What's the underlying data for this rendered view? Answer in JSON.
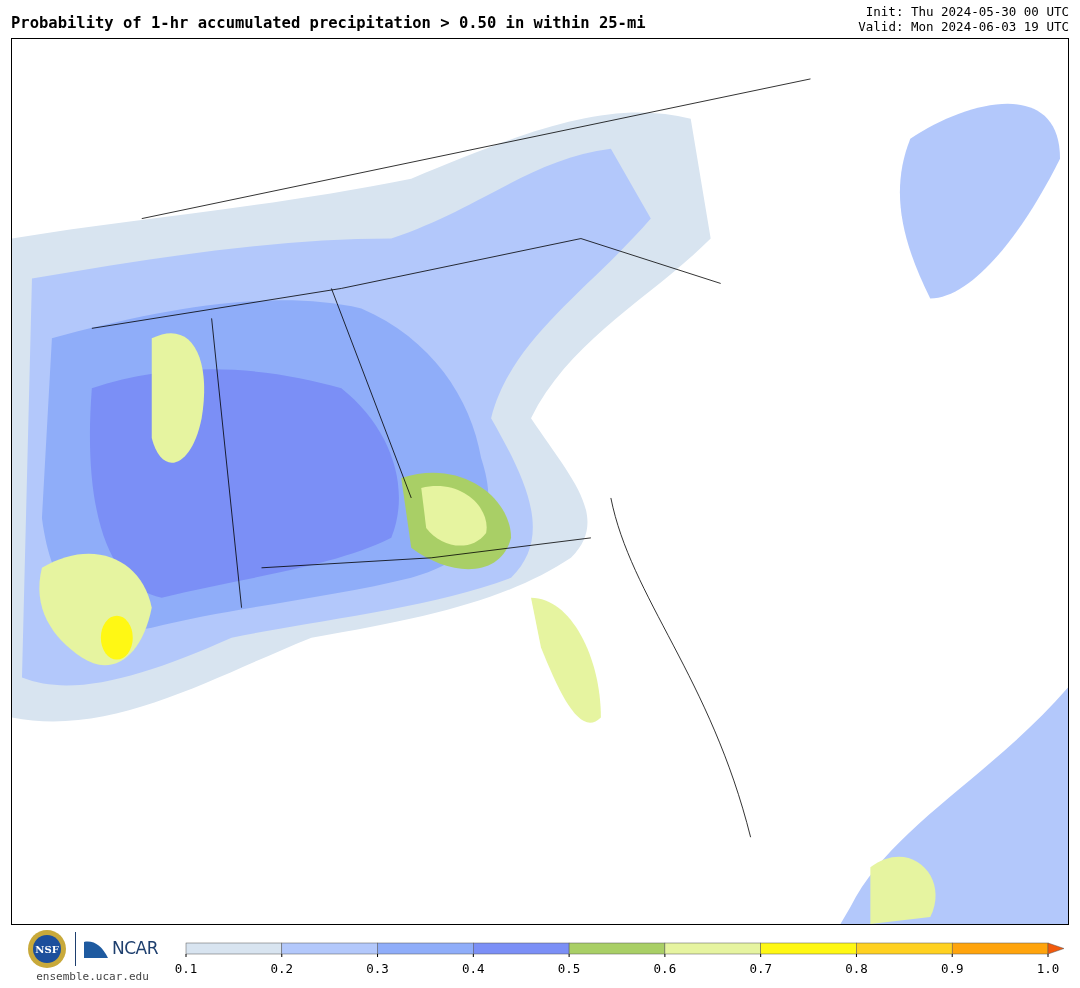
{
  "title": "Probability of 1-hr accumulated precipitation > 0.50 in within 25-mi",
  "init": "Init: Thu 2024-05-30 00 UTC",
  "valid": "Valid: Mon 2024-06-03 19 UTC",
  "logos": {
    "nsf": "NSF",
    "ncar": "NCAR",
    "site": "ensemble.ucar.edu"
  },
  "colorbar": {
    "bins": [
      {
        "color": "#d8e4f0"
      },
      {
        "color": "#b3c8fb"
      },
      {
        "color": "#8fadf9"
      },
      {
        "color": "#7b8ff6"
      },
      {
        "color": "#a9cf66"
      },
      {
        "color": "#e6f4a0"
      },
      {
        "color": "#fff814"
      },
      {
        "color": "#ffd120"
      },
      {
        "color": "#ffa40c"
      }
    ],
    "extend": {
      "color": "#f2590b"
    },
    "ticks": [
      "0.1",
      "0.2",
      "0.3",
      "0.4",
      "0.5",
      "0.6",
      "0.7",
      "0.8",
      "0.9",
      "1.0"
    ]
  }
}
